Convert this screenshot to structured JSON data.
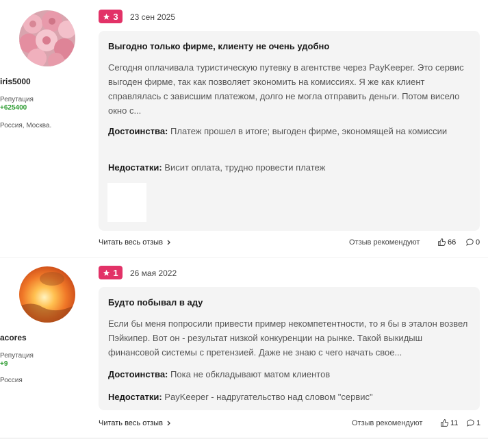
{
  "reviews": [
    {
      "user": {
        "name": "iris5000",
        "reputation_label": "Репутация",
        "reputation": "+625400",
        "location": "Россия, Москва."
      },
      "rating": "3",
      "date": "23 сен 2025",
      "title": "Выгодно только фирме, клиенту не очень удобно",
      "body": "Сегодня оплачивала туристическую путевку в агентстве через PayKeeper. Это сервис выгоден фирме, так как позволяет экономить на комиссиях. Я же как клиент справлялась с зависшим платежом, долго не могла отправить деньги. Потом висело окно с...",
      "pros_label": "Достоинства:",
      "pros": "Платеж прошел в итоге; выгоден фирме, экономящей на комиссии",
      "cons_label": "Недостатки:",
      "cons": "Висит оплата, трудно провести платеж",
      "read_more": "Читать весь отзыв",
      "recommend_label": "Отзыв рекомендуют",
      "likes": "66",
      "comments": "0",
      "colors": {
        "avatar": "#e8889a"
      }
    },
    {
      "user": {
        "name": "acores",
        "reputation_label": "Репутация",
        "reputation": "+9",
        "location": "Россия"
      },
      "rating": "1",
      "date": "26 мая 2022",
      "title": "Будто побывал в аду",
      "body": "Если бы меня попросили привести пример некомпетентности, то я бы в эталон возвел Пэйкипер. Вот он - результат низкой конкуренции на рынке. Такой выкидыш финансовой системы с претензией. Даже не знаю с чего начать свое...",
      "pros_label": "Достоинства:",
      "pros": "Пока не обкладывают матом клиентов",
      "cons_label": "Недостатки:",
      "cons": "PayKeeper - надругательство над словом \"сервис\"",
      "read_more": "Читать весь отзыв",
      "recommend_label": "Отзыв рекомендуют",
      "likes": "11",
      "comments": "1",
      "colors": {
        "avatar": "#f08030"
      }
    }
  ],
  "colors": {
    "badge": "#e23267",
    "reputation": "#2e9c32",
    "card": "#f4f4f4"
  }
}
